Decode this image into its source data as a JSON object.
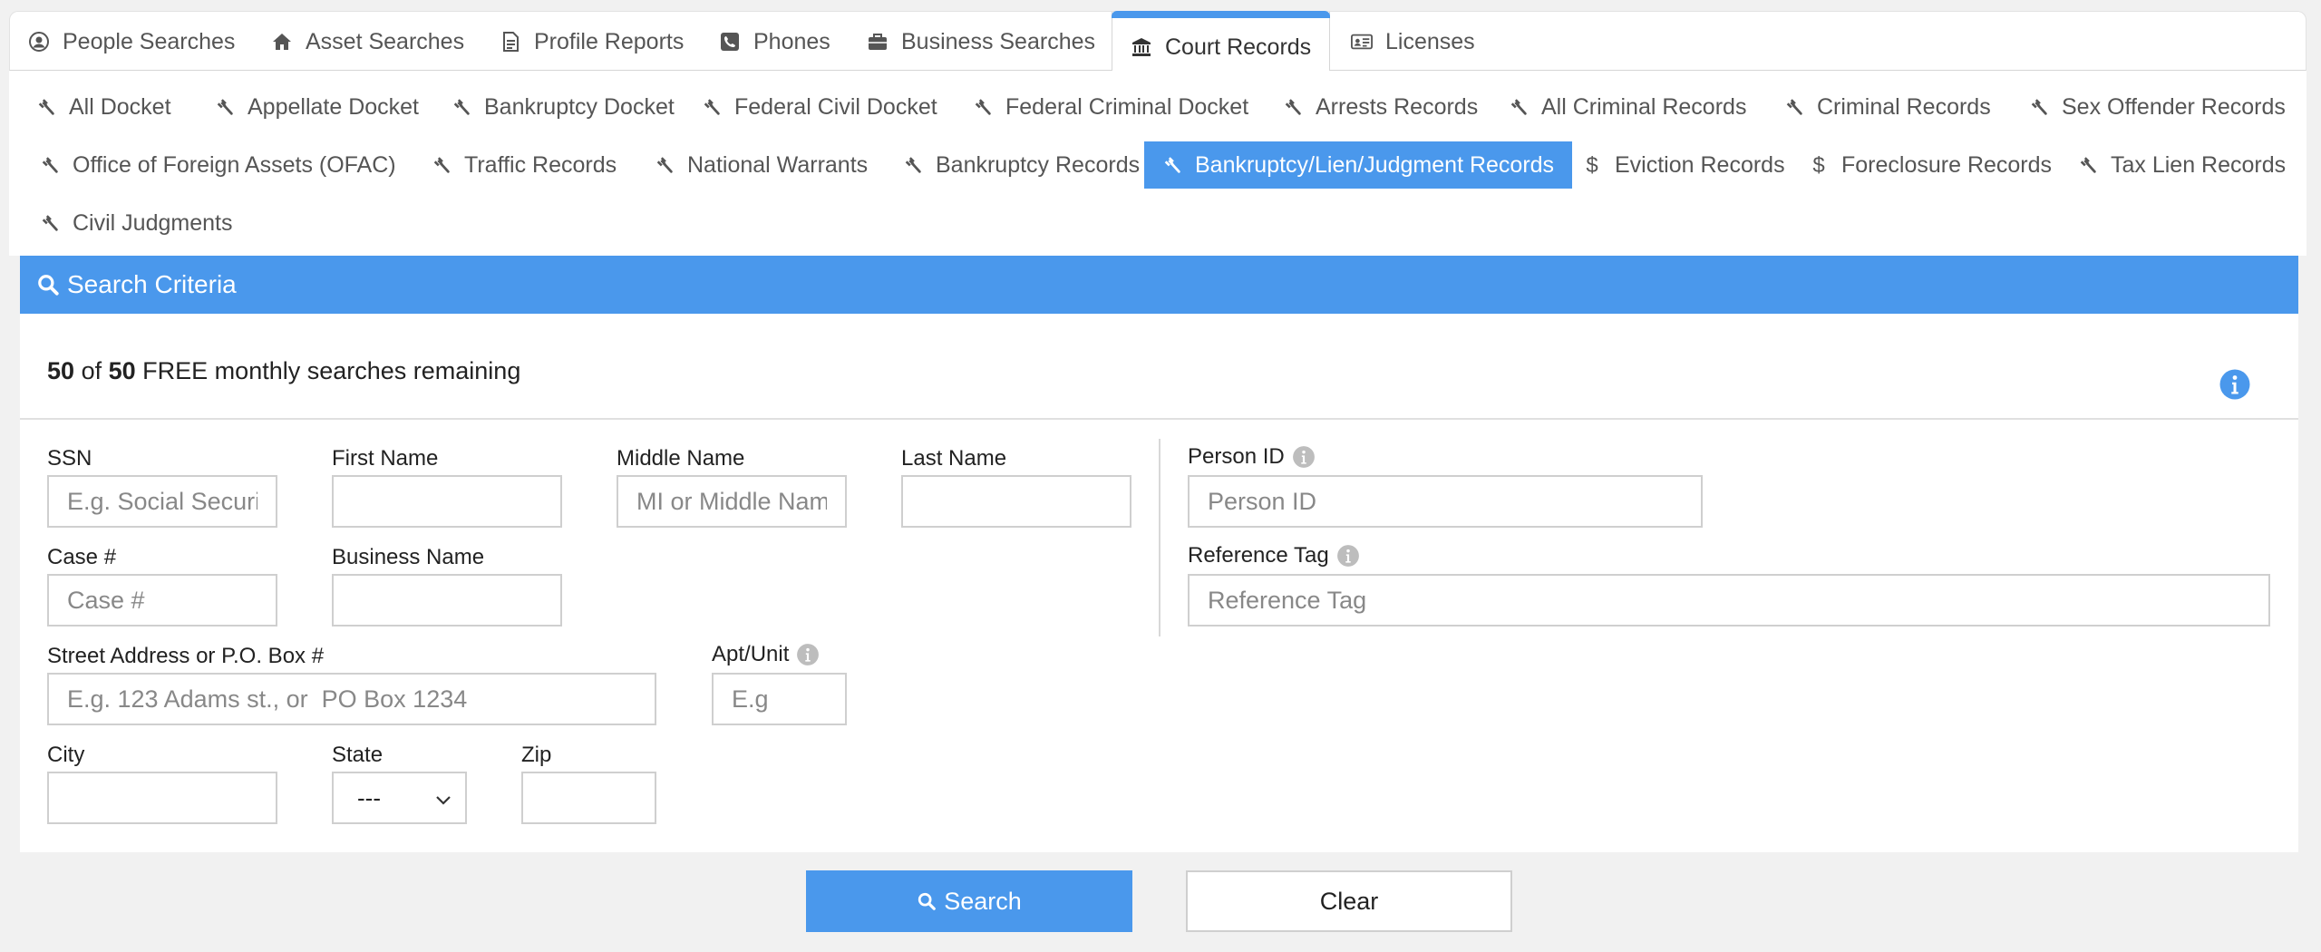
{
  "top_tabs": [
    {
      "label": "People Searches",
      "icon": "user-circle-icon"
    },
    {
      "label": "Asset Searches",
      "icon": "home-icon"
    },
    {
      "label": "Profile Reports",
      "icon": "document-icon"
    },
    {
      "label": "Phones",
      "icon": "phone-icon"
    },
    {
      "label": "Business Searches",
      "icon": "briefcase-icon"
    },
    {
      "label": "Court Records",
      "icon": "courthouse-icon",
      "active": true
    },
    {
      "label": "Licenses",
      "icon": "id-card-icon"
    }
  ],
  "sub_tabs": [
    {
      "label": "All Docket",
      "icon": "gavel-icon"
    },
    {
      "label": "Appellate Docket",
      "icon": "gavel-icon"
    },
    {
      "label": "Bankruptcy Docket",
      "icon": "gavel-icon"
    },
    {
      "label": "Federal Civil Docket",
      "icon": "gavel-icon"
    },
    {
      "label": "Federal Criminal Docket",
      "icon": "gavel-icon"
    },
    {
      "label": "Arrests Records",
      "icon": "gavel-icon"
    },
    {
      "label": "All Criminal Records",
      "icon": "gavel-icon"
    },
    {
      "label": "Criminal Records",
      "icon": "gavel-icon"
    },
    {
      "label": "Sex Offender Records",
      "icon": "gavel-icon"
    },
    {
      "label": "Office of Foreign Assets (OFAC)",
      "icon": "gavel-icon"
    },
    {
      "label": "Traffic Records",
      "icon": "gavel-icon"
    },
    {
      "label": "National Warrants",
      "icon": "gavel-icon"
    },
    {
      "label": "Bankruptcy Records",
      "icon": "gavel-icon"
    },
    {
      "label": "Bankruptcy/Lien/Judgment Records",
      "icon": "gavel-icon",
      "active": true
    },
    {
      "label": "Eviction Records",
      "icon": "dollar-icon"
    },
    {
      "label": "Foreclosure Records",
      "icon": "dollar-icon"
    },
    {
      "label": "Tax Lien Records",
      "icon": "gavel-icon"
    },
    {
      "label": "Civil Judgments",
      "icon": "gavel-icon"
    }
  ],
  "criteria": {
    "title": "Search Criteria",
    "quota_used": "50",
    "quota_of": "of",
    "quota_total": "50",
    "quota_suffix": "FREE monthly searches remaining"
  },
  "form": {
    "ssn": {
      "label": "SSN",
      "placeholder": "E.g. Social Security Number",
      "value": ""
    },
    "first_name": {
      "label": "First Name",
      "placeholder": "",
      "value": ""
    },
    "middle_name": {
      "label": "Middle Name",
      "placeholder": "MI or Middle Name",
      "value": ""
    },
    "last_name": {
      "label": "Last Name",
      "placeholder": "",
      "value": ""
    },
    "person_id": {
      "label": "Person ID",
      "placeholder": "Person ID",
      "value": ""
    },
    "case_no": {
      "label": "Case #",
      "placeholder": "Case #",
      "value": ""
    },
    "business_name": {
      "label": "Business Name",
      "placeholder": "",
      "value": ""
    },
    "reference_tag": {
      "label": "Reference Tag",
      "placeholder": "Reference Tag",
      "value": ""
    },
    "street": {
      "label": "Street Address or P.O. Box #",
      "placeholder": "E.g. 123 Adams st., or  PO Box 1234",
      "value": ""
    },
    "apt": {
      "label": "Apt/Unit",
      "placeholder": "E.g",
      "value": ""
    },
    "city": {
      "label": "City",
      "placeholder": "",
      "value": ""
    },
    "state": {
      "label": "State",
      "selected": "---"
    },
    "zip": {
      "label": "Zip",
      "placeholder": "",
      "value": ""
    }
  },
  "buttons": {
    "search": "Search",
    "clear": "Clear"
  },
  "colors": {
    "accent": "#4a98ec",
    "border": "#cfcfcf"
  }
}
